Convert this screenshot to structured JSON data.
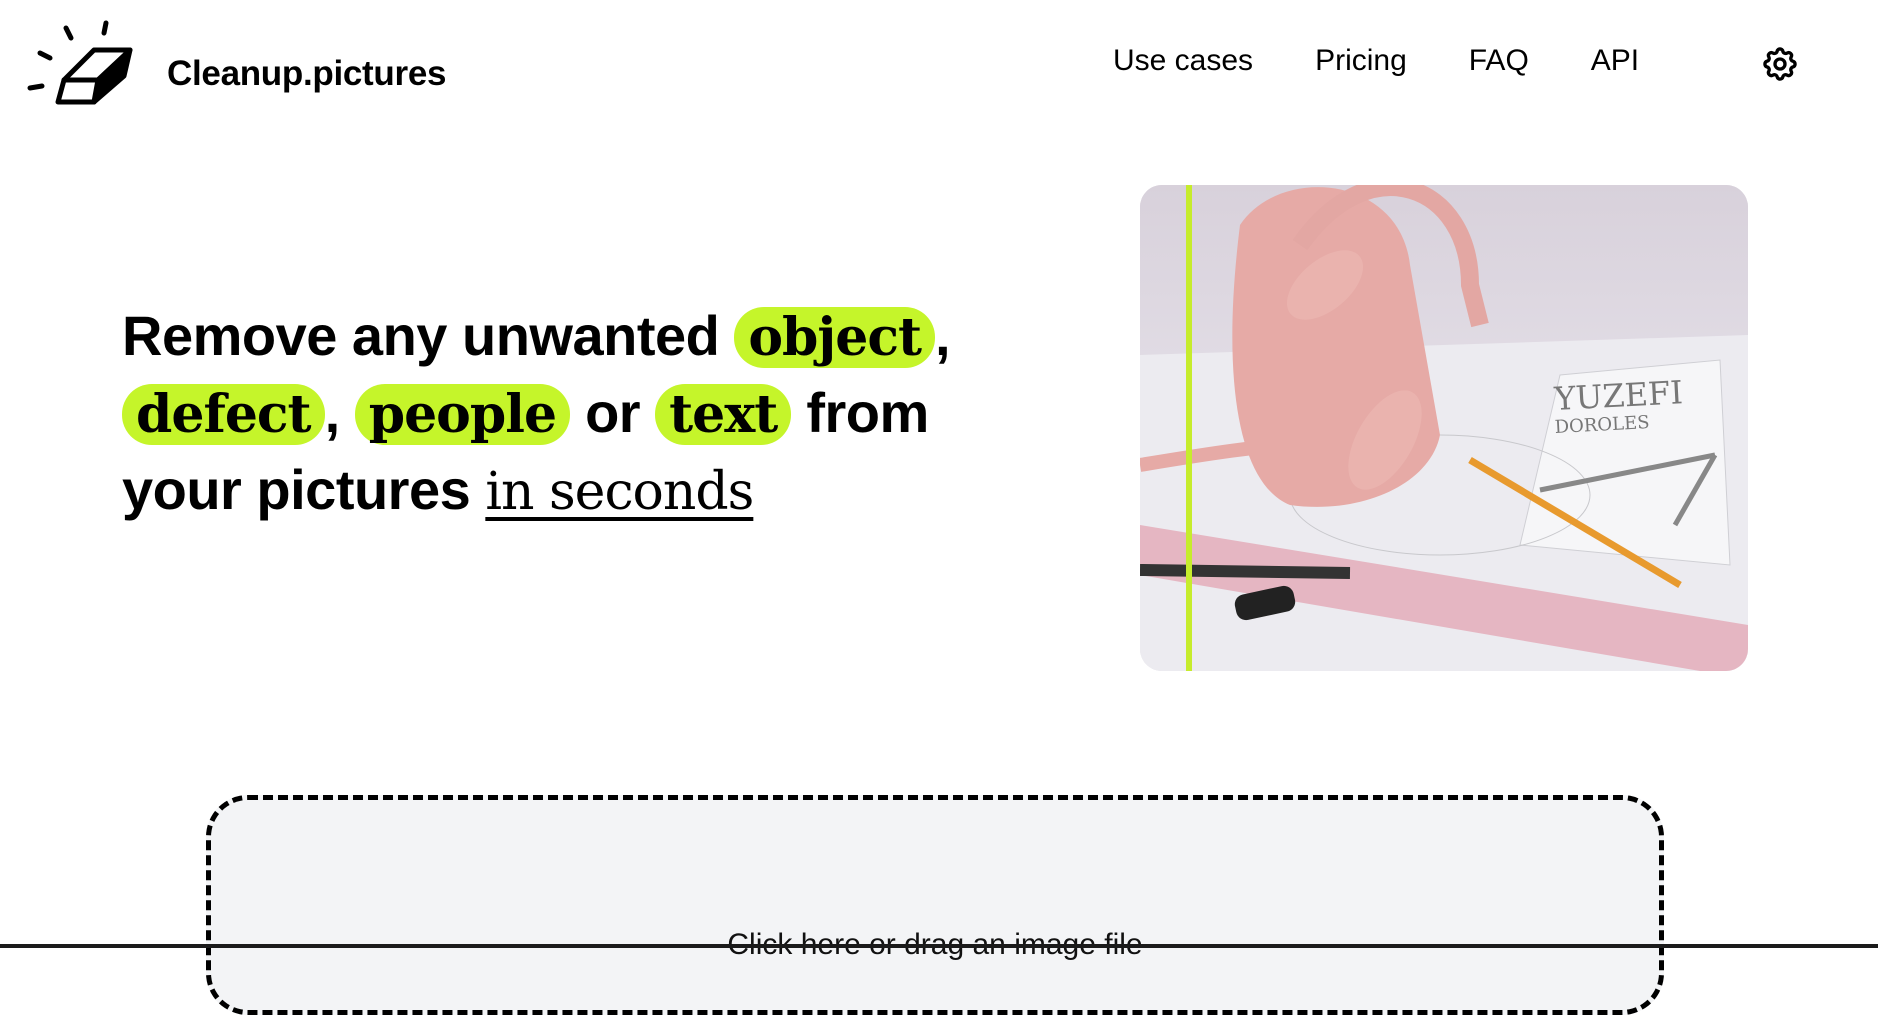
{
  "header": {
    "brand": "Cleanup.pictures",
    "logo_icon": "eraser-icon",
    "nav": [
      {
        "label": "Use cases"
      },
      {
        "label": "Pricing"
      },
      {
        "label": "FAQ"
      },
      {
        "label": "API"
      }
    ],
    "settings_icon": "gear-icon"
  },
  "hero": {
    "headline": {
      "part1": "Remove any unwanted ",
      "pill1": "object",
      "comma1": ",",
      "pill2": "defect",
      "comma2": ", ",
      "pill3": "people",
      "or": " or ",
      "pill4": "text",
      "from": " from",
      "line3": "your pictures ",
      "underline": "in seconds"
    },
    "image_alt": "Pink handbag with ruler, pencil, compass and pen on a drawing",
    "accent_color": "#c5f52a",
    "comparison_slider_position": 0.075
  },
  "dropzone": {
    "label": "Click here or drag an image file"
  }
}
